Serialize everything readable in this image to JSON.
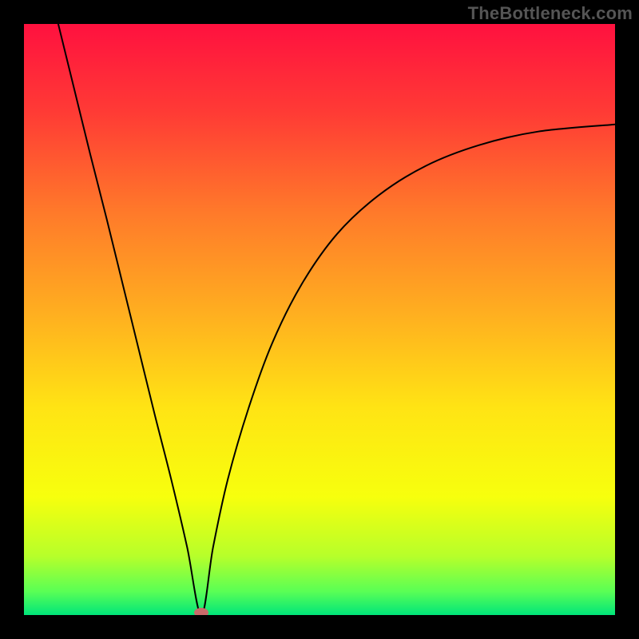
{
  "watermark": "TheBottleneck.com",
  "chart_data": {
    "type": "line",
    "title": "",
    "xlabel": "",
    "ylabel": "",
    "xlim": [
      0,
      1
    ],
    "ylim": [
      0,
      1
    ],
    "background_gradient": {
      "stops": [
        {
          "offset": 0.0,
          "color": "#ff113f"
        },
        {
          "offset": 0.15,
          "color": "#ff3b35"
        },
        {
          "offset": 0.32,
          "color": "#ff7a2a"
        },
        {
          "offset": 0.5,
          "color": "#ffb21f"
        },
        {
          "offset": 0.65,
          "color": "#ffe414"
        },
        {
          "offset": 0.8,
          "color": "#f7ff0d"
        },
        {
          "offset": 0.9,
          "color": "#b7ff2a"
        },
        {
          "offset": 0.96,
          "color": "#5aff55"
        },
        {
          "offset": 1.0,
          "color": "#00e57a"
        }
      ]
    },
    "curve": {
      "color": "#000000",
      "width": 2,
      "min_x": 0.3,
      "left_top_x": 0.058,
      "right_end": {
        "x": 1.0,
        "y": 0.83
      },
      "points_left": [
        {
          "x": 0.058,
          "y": 1.0
        },
        {
          "x": 0.085,
          "y": 0.89
        },
        {
          "x": 0.112,
          "y": 0.78
        },
        {
          "x": 0.14,
          "y": 0.67
        },
        {
          "x": 0.167,
          "y": 0.56
        },
        {
          "x": 0.194,
          "y": 0.45
        },
        {
          "x": 0.221,
          "y": 0.34
        },
        {
          "x": 0.249,
          "y": 0.23
        },
        {
          "x": 0.276,
          "y": 0.115
        },
        {
          "x": 0.3,
          "y": 0.0
        }
      ],
      "points_right": [
        {
          "x": 0.3,
          "y": 0.0
        },
        {
          "x": 0.32,
          "y": 0.115
        },
        {
          "x": 0.345,
          "y": 0.23
        },
        {
          "x": 0.38,
          "y": 0.35
        },
        {
          "x": 0.42,
          "y": 0.46
        },
        {
          "x": 0.47,
          "y": 0.56
        },
        {
          "x": 0.53,
          "y": 0.645
        },
        {
          "x": 0.6,
          "y": 0.71
        },
        {
          "x": 0.68,
          "y": 0.76
        },
        {
          "x": 0.77,
          "y": 0.795
        },
        {
          "x": 0.87,
          "y": 0.818
        },
        {
          "x": 1.0,
          "y": 0.83
        }
      ]
    },
    "marker": {
      "x": 0.3,
      "y": 0.0,
      "color": "#c96a6a",
      "rx": 9,
      "ry": 6
    }
  }
}
